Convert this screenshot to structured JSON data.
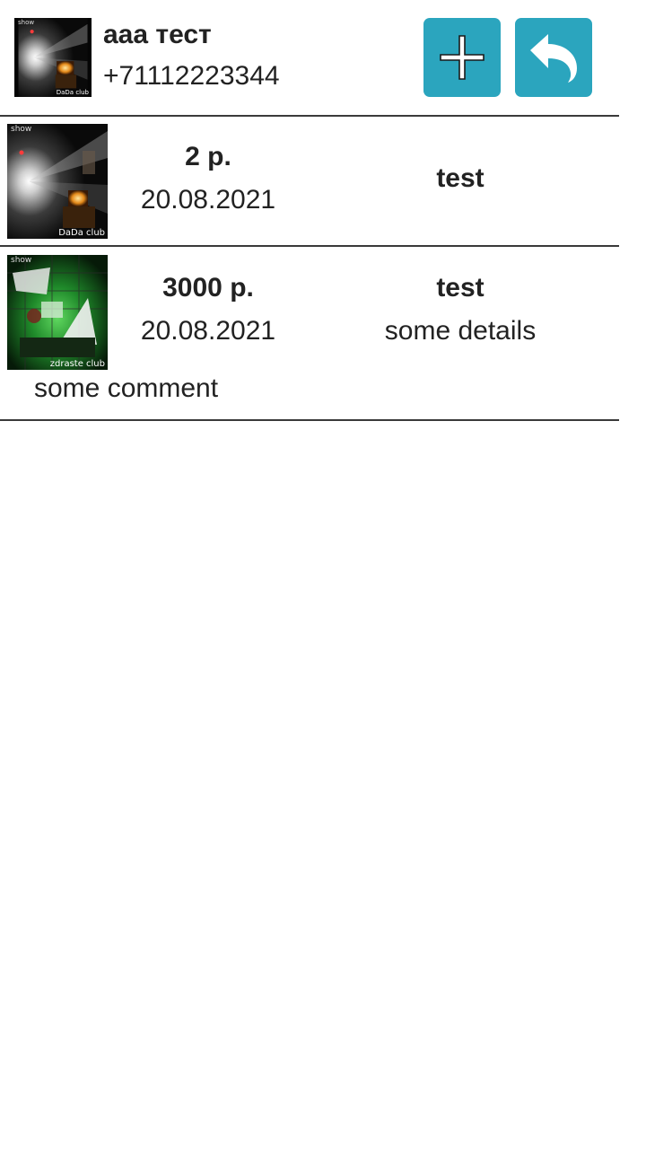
{
  "header": {
    "client_name": "aaa тест",
    "client_phone": "+71112223344",
    "thumb": {
      "caption_top": "show",
      "caption_bottom": "DaDa club"
    },
    "add_button_icon": "plus-icon",
    "back_button_icon": "undo-arrow-icon",
    "button_color": "#2BA5BE"
  },
  "transactions": [
    {
      "amount": "2 р.",
      "date": "20.08.2021",
      "title": "test",
      "details": "",
      "comment": "",
      "thumb": {
        "caption_top": "show",
        "caption_bottom": "DaDa club"
      }
    },
    {
      "amount": "3000 р.",
      "date": "20.08.2021",
      "title": "test",
      "details": "some details",
      "comment": "some comment",
      "thumb": {
        "caption_top": "show",
        "caption_bottom": "zdraste club"
      }
    }
  ]
}
